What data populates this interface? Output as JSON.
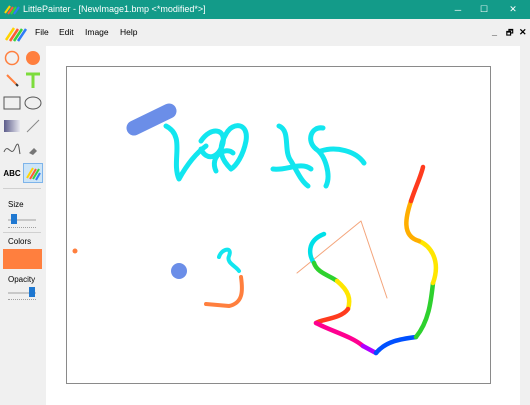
{
  "window": {
    "title": "LittlePainter - [NewImage1.bmp  <*modified*>]",
    "controls": {
      "minimize": "─",
      "maximize": "☐",
      "close": "✕"
    }
  },
  "menu": {
    "items": [
      "File",
      "Edit",
      "Image",
      "Help"
    ],
    "mdi_controls": {
      "minimize": "_",
      "restore": "🗗",
      "close": "✕"
    }
  },
  "tools": {
    "size_label": "Size",
    "size_level": 0.2,
    "colors_label": "Colors",
    "current_color": "#ff7f3e",
    "opacity_label": "Opacity",
    "opacity_level": 0.85,
    "text_tool_label": "ABC",
    "selected_tool": "fill-color"
  },
  "colors": {
    "titlebar": "#139b89",
    "blue_brush": "#6b8ee8",
    "cyan_brush": "#12e6ef",
    "orange": "#ff7f3e",
    "rainbow": [
      "#ff3b1e",
      "#ffae00",
      "#ffe600",
      "#2ed12e",
      "#00e0e8",
      "#0050ff",
      "#b000ff",
      "#ff0090"
    ]
  }
}
